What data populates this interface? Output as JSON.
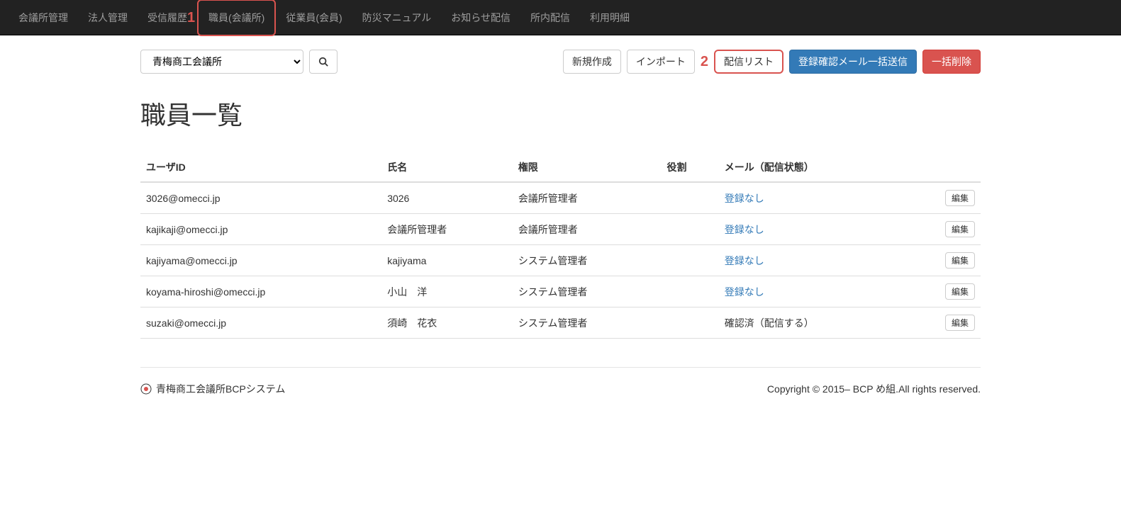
{
  "nav": {
    "items": [
      {
        "label": "会議所管理"
      },
      {
        "label": "法人管理"
      },
      {
        "label": "受信履歴"
      },
      {
        "label": "職員(会議所)",
        "highlight": true,
        "marker": "1"
      },
      {
        "label": "従業員(会員)"
      },
      {
        "label": "防災マニュアル"
      },
      {
        "label": "お知らせ配信"
      },
      {
        "label": "所内配信"
      },
      {
        "label": "利用明細"
      }
    ]
  },
  "toolbar": {
    "select_value": "青梅商工会議所",
    "new_label": "新規作成",
    "import_label": "インポート",
    "dist_list_label": "配信リスト",
    "dist_list_marker": "2",
    "bulk_mail_label": "登録確認メール一括送信",
    "bulk_delete_label": "一括削除"
  },
  "page_title": "職員一覧",
  "table": {
    "headers": {
      "user_id": "ユーザID",
      "name": "氏名",
      "permission": "権限",
      "role": "役割",
      "mail": "メール（配信状態）"
    },
    "edit_label": "編集",
    "rows": [
      {
        "user_id": "3026@omecci.jp",
        "name": "3026",
        "permission": "会議所管理者",
        "role": "",
        "mail": "登録なし",
        "mail_link": true
      },
      {
        "user_id": "kajikaji@omecci.jp",
        "name": "会議所管理者",
        "permission": "会議所管理者",
        "role": "",
        "mail": "登録なし",
        "mail_link": true
      },
      {
        "user_id": "kajiyama@omecci.jp",
        "name": "kajiyama",
        "permission": "システム管理者",
        "role": "",
        "mail": "登録なし",
        "mail_link": true
      },
      {
        "user_id": "koyama-hiroshi@omecci.jp",
        "name": "小山　洋",
        "permission": "システム管理者",
        "role": "",
        "mail": "登録なし",
        "mail_link": true
      },
      {
        "user_id": "suzaki@omecci.jp",
        "name": "須崎　花衣",
        "permission": "システム管理者",
        "role": "",
        "mail": "確認済（配信する）",
        "mail_link": false
      }
    ]
  },
  "footer": {
    "left": "青梅商工会議所BCPシステム",
    "right": "Copyright © 2015– BCP め組.All rights reserved."
  }
}
